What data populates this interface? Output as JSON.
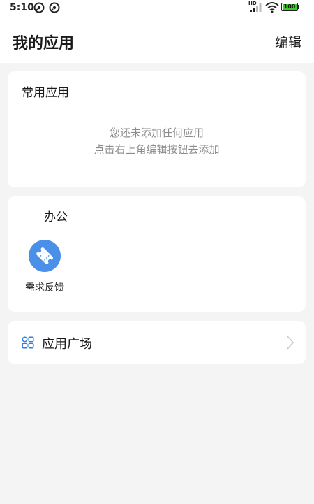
{
  "status_bar": {
    "time": "5:10",
    "battery": "100",
    "network_label": "HD"
  },
  "header": {
    "title": "我的应用",
    "edit_label": "编辑"
  },
  "frequent": {
    "title": "常用应用",
    "empty_line1": "您还未添加任何应用",
    "empty_line2": "点击右上角编辑按钮去添加"
  },
  "office": {
    "title": "办公",
    "apps": [
      {
        "label": "需求反馈",
        "icon": "ticket-icon",
        "color": "#4a90e8"
      }
    ]
  },
  "market": {
    "label": "应用广场",
    "icon": "grid-icon",
    "icon_color": "#2f7fe0"
  }
}
